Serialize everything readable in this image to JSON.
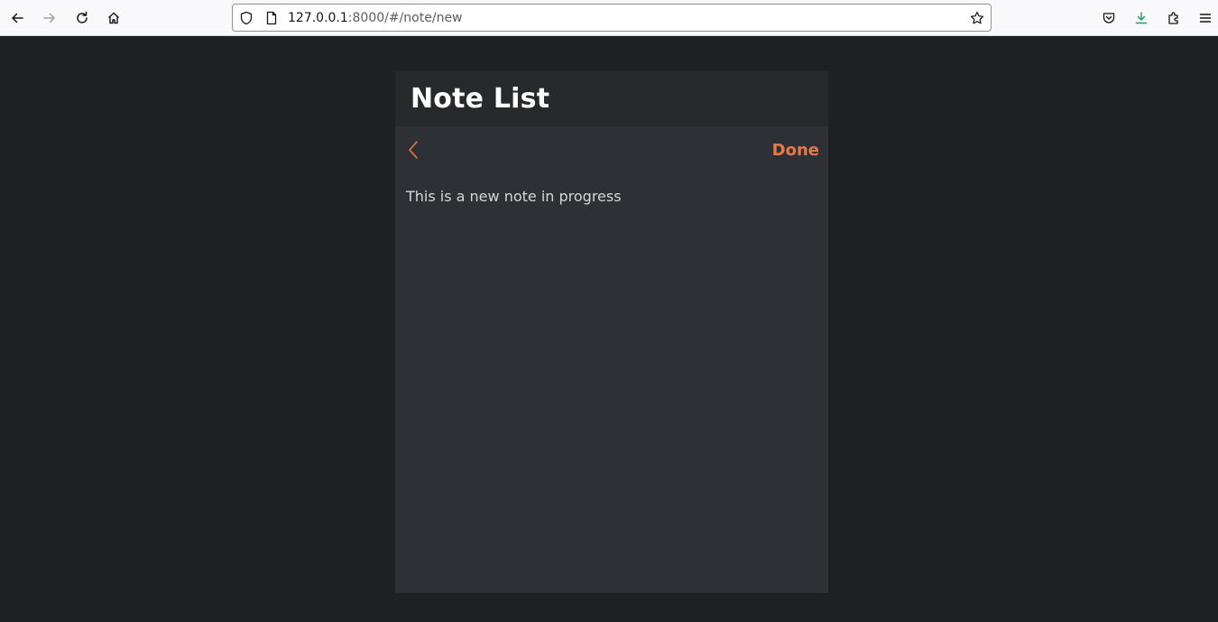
{
  "browser": {
    "url_host": "127.0.0.1",
    "url_rest": ":8000/#/note/new",
    "icons": [
      "back-arrow-icon",
      "forward-arrow-icon",
      "reload-icon",
      "home-icon",
      "shield-icon",
      "page-icon",
      "star-icon",
      "pocket-icon",
      "download-icon",
      "extensions-icon",
      "menu-icon"
    ]
  },
  "app": {
    "title": "Note List",
    "done_label": "Done",
    "note_text": "This is a new note in progress",
    "accent_color": "#e8784a"
  }
}
